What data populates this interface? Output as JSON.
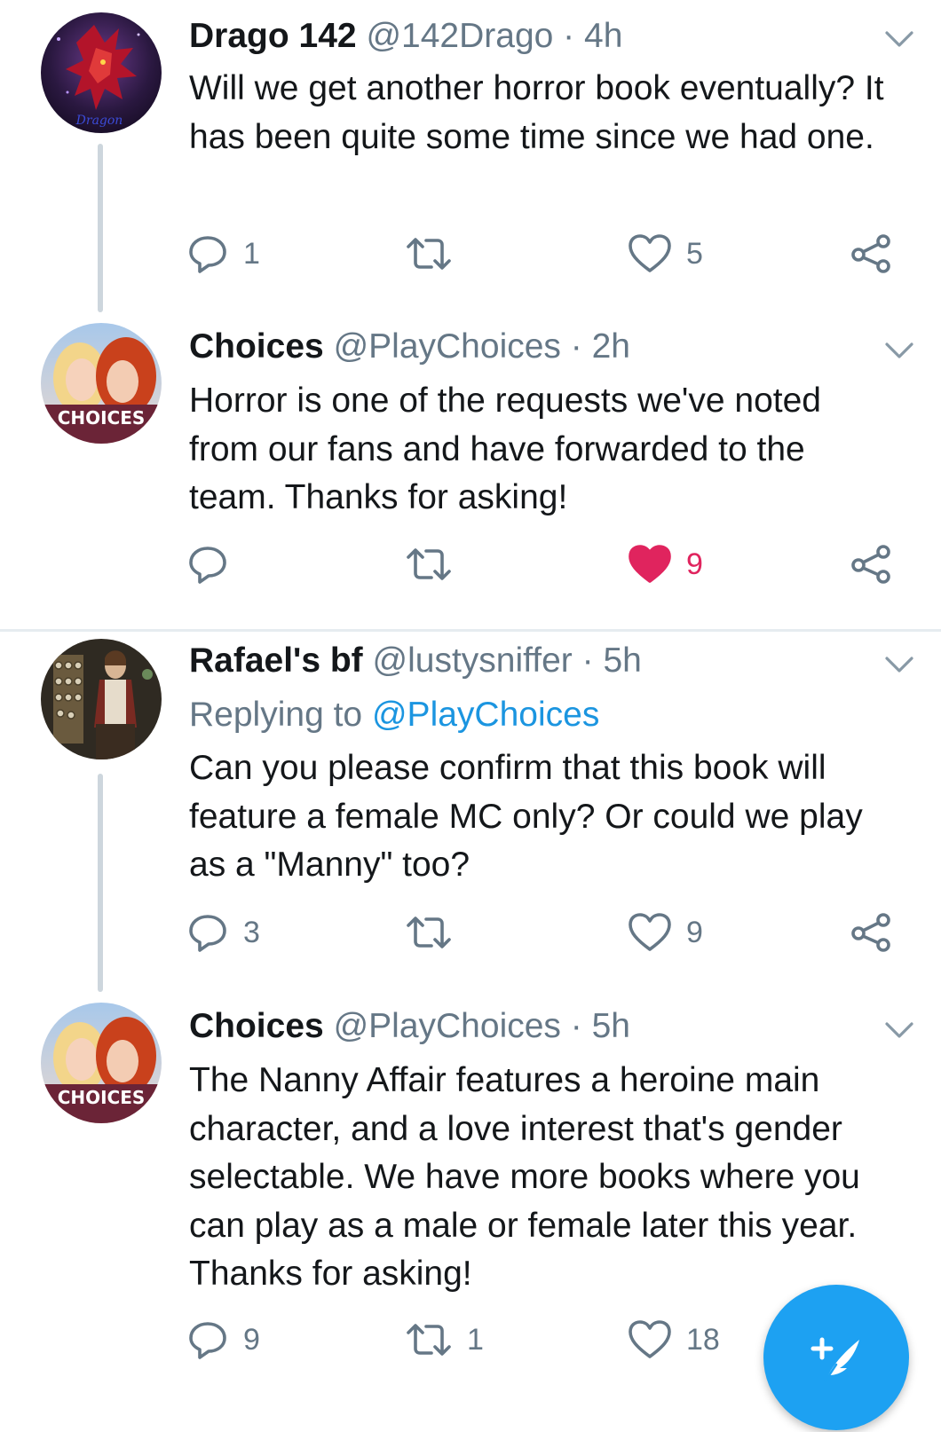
{
  "tweets": [
    {
      "name": "Drago 142",
      "handle": "@142Drago",
      "dot": "·",
      "time": "4h",
      "text": "Will we get another horror book eventually? It has been quite some time since we had one.",
      "replies": "1",
      "retweets": "",
      "likes": "5",
      "liked": false,
      "avatar_icon": "dragon-avatar",
      "avatar_text": "Dragon"
    },
    {
      "name": "Choices",
      "handle": "@PlayChoices",
      "dot": "·",
      "time": "2h",
      "text": "Horror is one of the requests we've noted from our fans and have forwarded to the team. Thanks for asking!",
      "replies": "",
      "retweets": "",
      "likes": "9",
      "liked": true,
      "avatar_icon": "choices-logo-avatar",
      "avatar_text": "CHOICES"
    },
    {
      "name": "Rafael's bf",
      "handle": "@lustysniffer",
      "dot": "·",
      "time": "5h",
      "replying_label": "Replying to",
      "replying_mention": "@PlayChoices",
      "text": "Can you please confirm that this book will feature a female MC only? Or could we play as a \"Manny\" too?",
      "replies": "3",
      "retweets": "",
      "likes": "9",
      "liked": false,
      "avatar_icon": "game-character-avatar"
    },
    {
      "name": "Choices",
      "handle": "@PlayChoices",
      "dot": "·",
      "time": "5h",
      "text": "The Nanny Affair features a heroine main character, and a love interest that's gender selectable. We have more books where you can play as a male or female later this year. Thanks for asking!",
      "replies": "9",
      "retweets": "1",
      "likes": "18",
      "liked": false,
      "avatar_icon": "choices-logo-avatar",
      "avatar_text": "CHOICES"
    }
  ],
  "compose_button": {
    "icon": "compose-feather-plus-icon"
  },
  "colors": {
    "link": "#1b95e0",
    "secondary": "#657786",
    "like_active": "#e0245e",
    "fab": "#1da1f2",
    "thread_line": "#cdd6dd"
  }
}
